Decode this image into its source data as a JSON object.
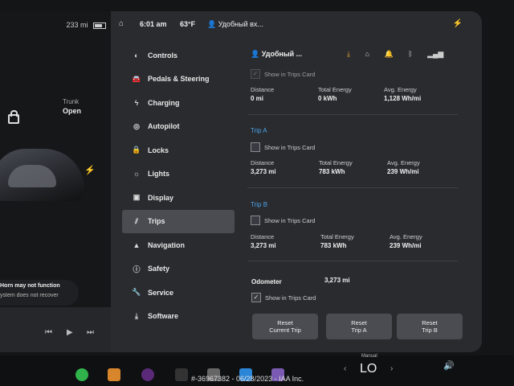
{
  "left": {
    "range": "233 mi",
    "trunk_label": "Trunk",
    "trunk_value": "Open",
    "warning_title": "Horn may not function",
    "warning_sub": "ystem does not recover"
  },
  "status": {
    "time": "6:01 am",
    "temp": "63°F",
    "user": "Удобный вх..."
  },
  "sidebar": {
    "items": [
      {
        "label": "Controls",
        "icon": "toggle-icon"
      },
      {
        "label": "Pedals & Steering",
        "icon": "car-icon"
      },
      {
        "label": "Charging",
        "icon": "bolt-icon"
      },
      {
        "label": "Autopilot",
        "icon": "steering-wheel-icon"
      },
      {
        "label": "Locks",
        "icon": "lock-icon"
      },
      {
        "label": "Lights",
        "icon": "sun-icon"
      },
      {
        "label": "Display",
        "icon": "display-icon"
      },
      {
        "label": "Trips",
        "icon": "trips-icon"
      },
      {
        "label": "Navigation",
        "icon": "navigation-icon"
      },
      {
        "label": "Safety",
        "icon": "info-icon"
      },
      {
        "label": "Service",
        "icon": "wrench-icon"
      },
      {
        "label": "Software",
        "icon": "download-icon"
      }
    ],
    "active": "Trips"
  },
  "trips": {
    "profile": "Удобный ...",
    "current": {
      "show_in_trips_card": "Show in Trips Card",
      "distance_label": "Distance",
      "distance": "0 mi",
      "energy_label": "Total Energy",
      "energy": "0 kWh",
      "avg_label": "Avg. Energy",
      "avg": "1,128 Wh/mi"
    },
    "trip_a": {
      "title": "Trip A",
      "show_in_trips_card": "Show in Trips Card",
      "distance_label": "Distance",
      "distance": "3,273 mi",
      "energy_label": "Total Energy",
      "energy": "783 kWh",
      "avg_label": "Avg. Energy",
      "avg": "239 Wh/mi"
    },
    "trip_b": {
      "title": "Trip B",
      "show_in_trips_card": "Show in Trips Card",
      "distance_label": "Distance",
      "distance": "3,273 mi",
      "energy_label": "Total Energy",
      "energy": "783 kWh",
      "avg_label": "Avg. Energy",
      "avg": "239 Wh/mi"
    },
    "odometer_label": "Odometer",
    "odometer": "3,273 mi",
    "odometer_show": "Show in Trips Card",
    "buttons": {
      "reset_current_1": "Reset",
      "reset_current_2": "Current Trip",
      "reset_a_1": "Reset",
      "reset_a_2": "Trip A",
      "reset_b_1": "Reset",
      "reset_b_2": "Trip B"
    }
  },
  "taskbar": {
    "gear_label": "Manual",
    "gear_value": "LO"
  },
  "watermark": "#-36967382 - 06/28/2023 - IAA Inc.",
  "colors": {
    "accent": "#4aa3e8",
    "active_bg": "#4a4c52",
    "warning": "#e8a63a"
  }
}
